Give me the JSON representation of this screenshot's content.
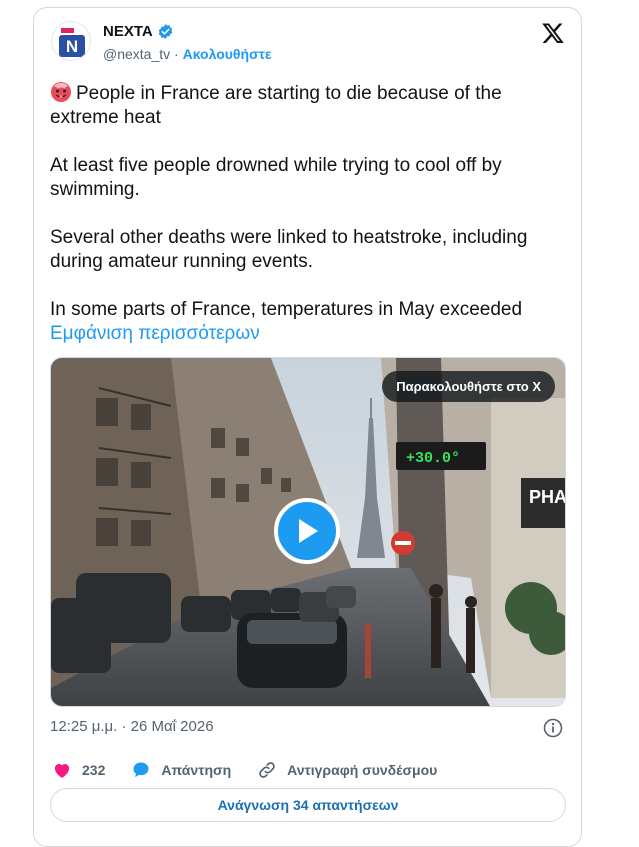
{
  "author": {
    "name": "NEXTA",
    "handle": "@nexta_tv",
    "separator": "·",
    "follow_label": "Ακολουθήστε",
    "avatar_letter": "N"
  },
  "tweet": {
    "paragraphs": [
      "People in France are starting to die because of the extreme heat",
      "At least five people drowned while trying to cool off by swimming.",
      "Several other deaths were linked to heatstroke, including during amateur running events.",
      "In some parts of France, temperatures in May exceeded"
    ],
    "show_more": "Εμφάνιση περισσότερων"
  },
  "media": {
    "watch_label": "Παρακολουθήστε στο X",
    "thermometer_text": "+30.0°",
    "shop_sign": "PHA"
  },
  "meta": {
    "timestamp": "12:25 μ.μ. · 26 Μαΐ 2026"
  },
  "actions": {
    "likes": "232",
    "reply_label": "Απάντηση",
    "copy_link_label": "Αντιγραφή συνδέσμου"
  },
  "read_replies_label": "Ανάγνωση 34 απαντήσεων",
  "colors": {
    "accent": "#1d9bf0",
    "like": "#f91880",
    "text": "#0f1419",
    "secondary": "#536471"
  }
}
